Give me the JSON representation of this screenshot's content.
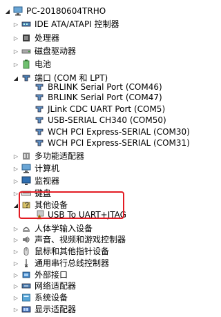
{
  "root": {
    "label": "PC-20180604TRHO",
    "icon": "computer-icon"
  },
  "items": [
    {
      "label": "IDE ATA/ATAPI 控制器",
      "icon": "ide-controller-icon",
      "toggle": "collapsed"
    },
    {
      "label": "处理器",
      "icon": "cpu-icon",
      "toggle": "collapsed"
    },
    {
      "label": "磁盘驱动器",
      "icon": "disk-drive-icon",
      "toggle": "collapsed"
    },
    {
      "label": "电池",
      "icon": "battery-icon",
      "toggle": "collapsed"
    },
    {
      "label": "端口 (COM 和 LPT)",
      "icon": "port-icon",
      "toggle": "expanded"
    },
    {
      "label": "BRLINK Serial Port (COM46)",
      "icon": "serial-port-icon",
      "toggle": "none"
    },
    {
      "label": "BRLINK Serial Port (COM47)",
      "icon": "serial-port-icon",
      "toggle": "none"
    },
    {
      "label": "JLink CDC UART Port (COM5)",
      "icon": "serial-port-icon",
      "toggle": "none"
    },
    {
      "label": "USB-SERIAL CH340 (COM50)",
      "icon": "serial-port-icon",
      "toggle": "none"
    },
    {
      "label": "WCH PCI Express-SERIAL (COM30)",
      "icon": "serial-port-icon",
      "toggle": "none"
    },
    {
      "label": "WCH PCI Express-SERIAL (COM31)",
      "icon": "serial-port-icon",
      "toggle": "none"
    },
    {
      "label": "多功能适配器",
      "icon": "multifunction-adapter-icon",
      "toggle": "collapsed"
    },
    {
      "label": "计算机",
      "icon": "computer-icon",
      "toggle": "collapsed"
    },
    {
      "label": "监视器",
      "icon": "monitor-icon",
      "toggle": "collapsed"
    },
    {
      "label": "键盘",
      "icon": "keyboard-icon",
      "toggle": "collapsed"
    },
    {
      "label": "其他设备",
      "icon": "unknown-device-icon",
      "toggle": "expanded"
    },
    {
      "label": "USB To UART+JTAG",
      "icon": "warning-device-icon",
      "toggle": "none"
    },
    {
      "label": "人体学输入设备",
      "icon": "hid-icon",
      "toggle": "collapsed"
    },
    {
      "label": "声音、视频和游戏控制器",
      "icon": "sound-icon",
      "toggle": "collapsed"
    },
    {
      "label": "鼠标和其他指针设备",
      "icon": "mouse-icon",
      "toggle": "collapsed"
    },
    {
      "label": "通用串行总线控制器",
      "icon": "usb-icon",
      "toggle": "collapsed"
    },
    {
      "label": "外部接口",
      "icon": "external-port-icon",
      "toggle": "collapsed"
    },
    {
      "label": "网络适配器",
      "icon": "network-adapter-icon",
      "toggle": "collapsed"
    },
    {
      "label": "系统设备",
      "icon": "system-device-icon",
      "toggle": "collapsed"
    },
    {
      "label": "显示适配器",
      "icon": "display-adapter-icon",
      "toggle": "collapsed"
    }
  ],
  "colors": {
    "highlight": "#e31b23",
    "text": "#000000",
    "background": "#ffffff"
  }
}
